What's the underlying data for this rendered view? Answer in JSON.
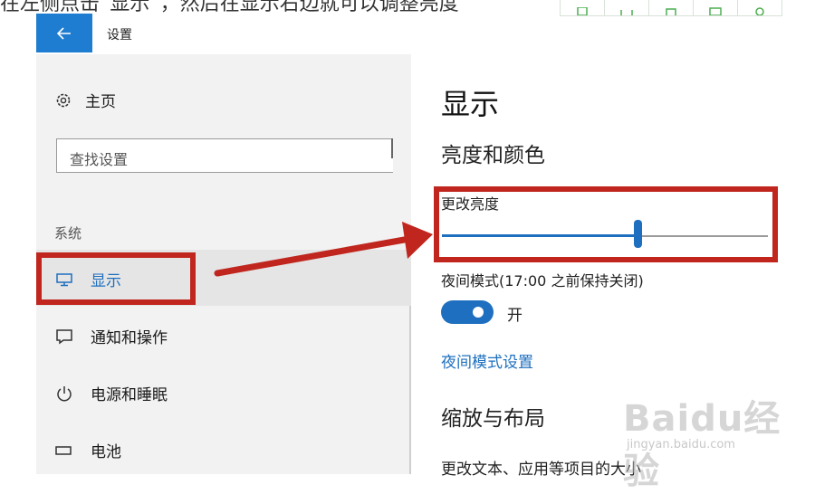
{
  "top_strip": {
    "article_text": "在左侧点击“显示”，然后在显示右边就可以调整亮度",
    "toolbar_icons": [
      "copy-icon",
      "fullscreen-icon",
      "home-icon",
      "image-icon",
      "settings-icon"
    ]
  },
  "header": {
    "title": "设置"
  },
  "sidebar": {
    "home_label": "主页",
    "search_placeholder": "查找设置",
    "section_label": "系统",
    "items": [
      {
        "label": "显示",
        "icon": "monitor-icon",
        "selected": true
      },
      {
        "label": "通知和操作",
        "icon": "notification-icon",
        "selected": false
      },
      {
        "label": "电源和睡眠",
        "icon": "power-icon",
        "selected": false
      },
      {
        "label": "电池",
        "icon": "battery-icon",
        "selected": false
      }
    ]
  },
  "main": {
    "title": "显示",
    "brightness_section": "亮度和颜色",
    "brightness_label": "更改亮度",
    "brightness_level": 0.6,
    "night_mode_label": "夜间模式(17:00 之前保持关闭)",
    "night_toggle_state": "开",
    "night_settings_link": "夜间模式设置",
    "scale_section": "缩放与布局",
    "cut_text": "更改文本、应用等项目的大小"
  },
  "watermark": {
    "logo": "Baidu经验",
    "url": "jingyan.baidu.com"
  },
  "colors": {
    "accent": "#1e6fbf",
    "header_blue": "#1e7dd0",
    "annotation_red": "#c0261e"
  }
}
